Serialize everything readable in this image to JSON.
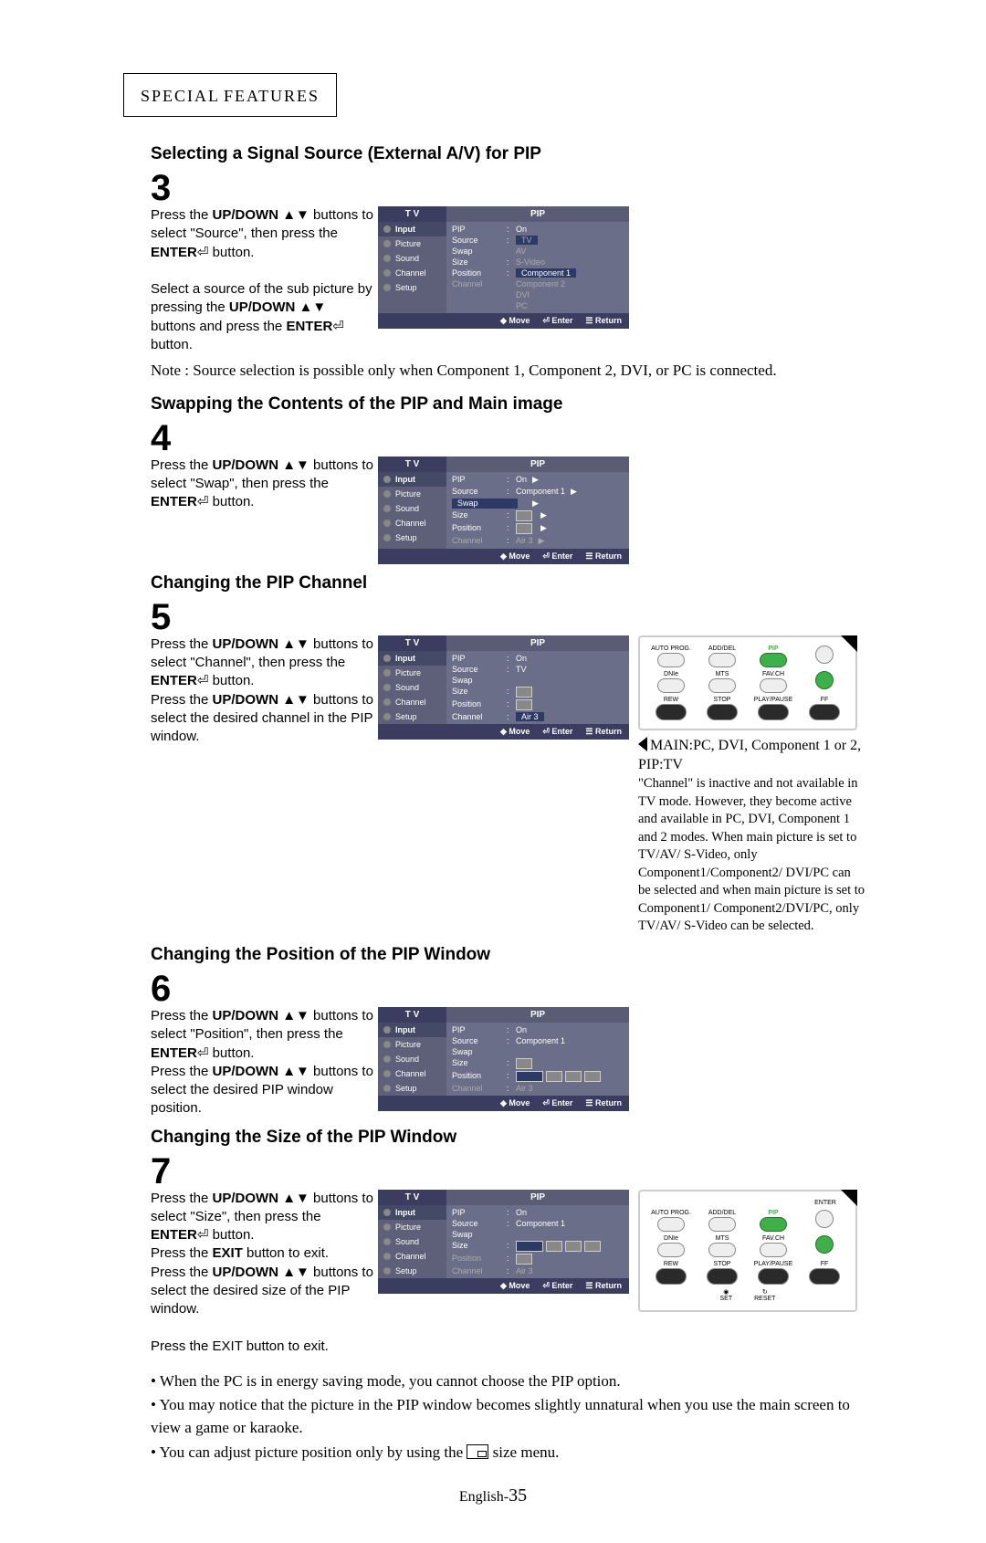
{
  "section_header": {
    "prefix": "S",
    "rest1": "PECIAL",
    "space": " ",
    "prefix2": "F",
    "rest2": "EATURES"
  },
  "steps": [
    {
      "number": "3",
      "heading": "Selecting a Signal Source (External A/V) for PIP",
      "para1_a": "Press the ",
      "para1_b": "UP/DOWN",
      "para1_c": " ▲▼ buttons to select \"Source\", then press the ",
      "para1_d": "ENTER",
      "para1_e": " button.",
      "para2_a": "Select a source of the sub picture by pressing the ",
      "para2_b": "UP/DOWN",
      "para2_c": " ▲▼ buttons and press the ",
      "para2_d": "ENTER",
      "para2_e": " button.",
      "osd": {
        "title_left": "T V",
        "title_right": "PIP",
        "left": [
          "Input",
          "Picture",
          "Sound",
          "Channel",
          "Setup"
        ],
        "rows": [
          {
            "lab": "PIP",
            "val": "On"
          },
          {
            "lab": "Source",
            "val": "TV",
            "hl": true,
            "dim": true
          },
          {
            "lab": "Swap",
            "val": "AV",
            "dim": true
          },
          {
            "lab": "Size",
            "val": "S-Video",
            "dim": true
          },
          {
            "lab": "Position",
            "val": "Component 1",
            "hl": true
          },
          {
            "lab": "Channel",
            "val": "Component 2",
            "dim2": true
          },
          {
            "lab": "",
            "val": "DVI",
            "dim": true
          },
          {
            "lab": "",
            "val": "PC",
            "dim": true
          }
        ],
        "footer": [
          "◆ Move",
          "⏎ Enter",
          "☰ Return"
        ]
      },
      "note": "Note : Source selection is possible only when Component 1, Component 2, DVI, or PC is connected."
    },
    {
      "number": "4",
      "heading": "Swapping the Contents of the PIP and Main image",
      "para1_a": "Press the ",
      "para1_b": "UP/DOWN",
      "para1_c": " ▲▼ buttons to select \"Swap\", then press the ",
      "para1_d": "ENTER",
      "para1_e": " button.",
      "osd": {
        "title_left": "T V",
        "title_right": "PIP",
        "left": [
          "Input",
          "Picture",
          "Sound",
          "Channel",
          "Setup"
        ],
        "rows": [
          {
            "lab": "PIP",
            "val": "On",
            "tri": true
          },
          {
            "lab": "Source",
            "val": "Component 1",
            "tri": true
          },
          {
            "lab": "Swap",
            "val": "",
            "hl": true,
            "tri": true
          },
          {
            "lab": "Size",
            "val": "",
            "icon": true,
            "tri": true
          },
          {
            "lab": "Position",
            "val": "",
            "icon": true,
            "tri": true
          },
          {
            "lab": "Channel",
            "val": "Air     3",
            "dim2": true,
            "tri": true
          }
        ],
        "footer": [
          "◆ Move",
          "⏎ Enter",
          "☰ Return"
        ]
      }
    },
    {
      "number": "5",
      "heading": "Changing the PIP Channel",
      "para1_a": "Press the ",
      "para1_b": "UP/DOWN",
      "para1_c": " ▲▼ buttons to select \"Channel\", then press the ",
      "para1_d": "ENTER",
      "para1_e": " button.",
      "para2_a": "Press the ",
      "para2_b": "UP/DOWN",
      "para2_c": " ▲▼ buttons to select the desired channel in the PIP window.",
      "osd": {
        "title_left": "T V",
        "title_right": "PIP",
        "left": [
          "Input",
          "Picture",
          "Sound",
          "Channel",
          "Setup"
        ],
        "rows": [
          {
            "lab": "PIP",
            "val": "On"
          },
          {
            "lab": "Source",
            "val": "TV"
          },
          {
            "lab": "Swap",
            "val": ""
          },
          {
            "lab": "Size",
            "val": "",
            "icon": true
          },
          {
            "lab": "Position",
            "val": "",
            "icon": true
          },
          {
            "lab": "Channel",
            "val": "Air     3",
            "hl": true
          }
        ],
        "footer": [
          "◆ Move",
          "⏎ Enter",
          "☰ Return"
        ]
      }
    },
    {
      "number": "6",
      "heading": "Changing the Position of the PIP Window",
      "para1_a": "Press the ",
      "para1_b": "UP/DOWN",
      "para1_c": " ▲▼ buttons to select \"Position\", then press the ",
      "para1_d": "ENTER",
      "para1_e": " button.",
      "para2_a": "Press the ",
      "para2_b": "UP/DOWN",
      "para2_c": " ▲▼ buttons to select the desired PIP window position.",
      "osd": {
        "title_left": "T V",
        "title_right": "PIP",
        "left": [
          "Input",
          "Picture",
          "Sound",
          "Channel",
          "Setup"
        ],
        "rows": [
          {
            "lab": "PIP",
            "val": "On"
          },
          {
            "lab": "Source",
            "val": "Component 1"
          },
          {
            "lab": "Swap",
            "val": ""
          },
          {
            "lab": "Size",
            "val": "",
            "icon": true
          },
          {
            "lab": "Position",
            "val": "",
            "icon4": true,
            "hl": true
          },
          {
            "lab": "Channel",
            "val": "Air     3",
            "dim2": true
          }
        ],
        "footer": [
          "◆ Move",
          "⏎ Enter",
          "☰ Return"
        ]
      }
    },
    {
      "number": "7",
      "heading": "Changing the Size of the PIP Window",
      "para1_a": "Press the ",
      "para1_b": "UP/DOWN",
      "para1_c": " ▲▼ buttons to select \"Size\", then press the ",
      "para1_d": "ENTER",
      "para1_e": " button.",
      "para_exit": "Press the EXIT button to exit.",
      "para2_a": "Press the ",
      "para2_b": "UP/DOWN",
      "para2_c": " ▲▼ buttons to select the desired size of the PIP window.",
      "para_exit2": "Press the EXIT button to exit.",
      "osd": {
        "title_left": "T V",
        "title_right": "PIP",
        "left": [
          "Input",
          "Picture",
          "Sound",
          "Channel",
          "Setup"
        ],
        "rows": [
          {
            "lab": "PIP",
            "val": "On"
          },
          {
            "lab": "Source",
            "val": "Component 1"
          },
          {
            "lab": "Swap",
            "val": ""
          },
          {
            "lab": "Size",
            "val": "",
            "icon3": true,
            "hl": true
          },
          {
            "lab": "Position",
            "val": "",
            "icon": true,
            "dim2": true
          },
          {
            "lab": "Channel",
            "val": "Air     3",
            "dim2": true
          }
        ],
        "footer": [
          "◆ Move",
          "⏎ Enter",
          "☰ Return"
        ]
      }
    }
  ],
  "remote1": {
    "row1": [
      "AUTO PROG.",
      "ADD/DEL",
      "PIP",
      ""
    ],
    "row2": [
      "DNIe",
      "MTS",
      "FAV.CH",
      ""
    ],
    "row3": [
      "REW",
      "STOP",
      "PLAY/PAUSE",
      "FF"
    ]
  },
  "side_text1a": "MAIN:PC, DVI, Component 1 or 2, PIP:TV",
  "side_text1b": "\"Channel\" is inactive and not available in TV mode. However, they become active and available in PC, DVI, Component 1 and 2 modes. When main picture is set to TV/AV/ S-Video, only Component1/Component2/ DVI/PC can be selected and when main picture is set to Component1/ Component2/DVI/PC, only TV/AV/ S-Video can be selected.",
  "remote2": {
    "row0_right": "ENTER",
    "row1": [
      "AUTO PROG.",
      "ADD/DEL",
      "PIP",
      ""
    ],
    "row2": [
      "DNIe",
      "MTS",
      "FAV.CH",
      ""
    ],
    "row3": [
      "REW",
      "STOP",
      "PLAY/PAUSE",
      "FF"
    ],
    "row4": [
      "◉ SET",
      "↻ RESET"
    ]
  },
  "bullets": [
    "When the PC is in energy saving mode, you cannot choose the PIP option.",
    "You may notice that the picture in the PIP window becomes slightly unnatural when you use the main screen to view a game or karaoke.",
    "You can adjust picture position only by using the  size menu."
  ],
  "footer": {
    "lang": "English-",
    "page": "35"
  }
}
